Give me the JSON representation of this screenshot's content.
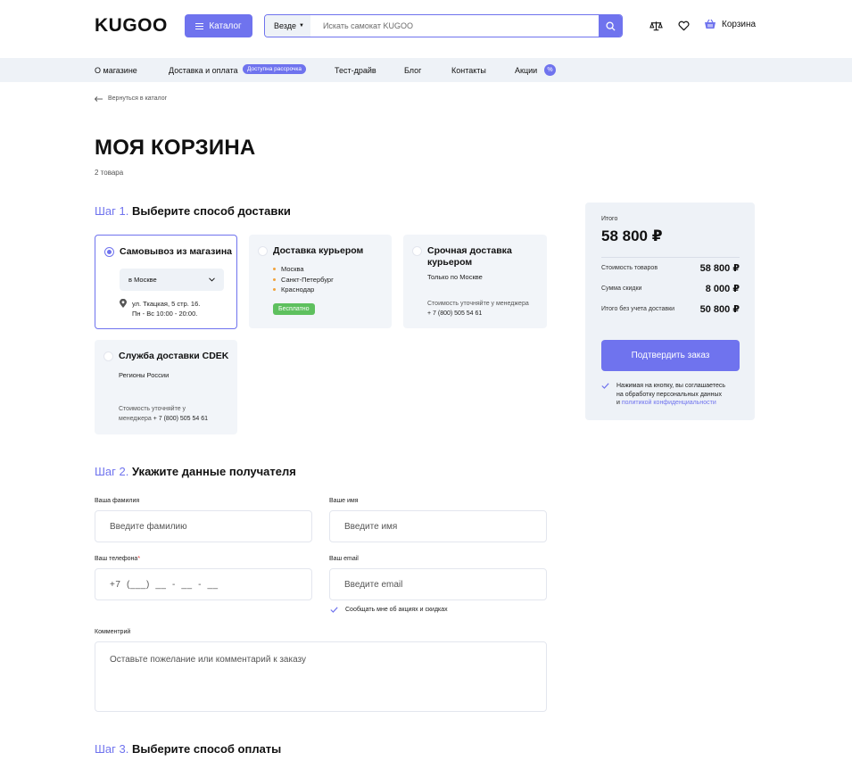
{
  "header": {
    "logo": "KUGOO",
    "catalog_label": "Каталог",
    "search_scope": "Везде",
    "search_placeholder": "Искать самокат KUGOO",
    "cart_label": "Корзина"
  },
  "nav": {
    "items": [
      "О магазине",
      "Доставка и оплата",
      "Тест-драйв",
      "Блог",
      "Контакты",
      "Акции"
    ],
    "installment_badge": "Доступна рассрочка",
    "percent_badge": "%"
  },
  "page": {
    "back_link": "Вернуться в каталог",
    "title": "МОЯ КОРЗИНА",
    "count": "2 товара"
  },
  "step1": {
    "num": "Шаг 1.",
    "title": "Выберите способ доставки",
    "options": [
      {
        "title": "Самовывоз из магазина",
        "city": "в Москве",
        "address_line1": "ул. Ткацкая, 5 стр. 16.",
        "address_line2": "Пн - Вс 10:00 - 20:00."
      },
      {
        "title": "Доставка курьером",
        "cities": [
          "Москва",
          "Санкт-Петербург",
          "Краснодар"
        ],
        "badge": "Бесплатно"
      },
      {
        "title_line1": "Срочная доставка",
        "title_line2": "курьером",
        "subtitle": "Только по Москве",
        "note_line1": "Стоимость уточняйте у менеджера",
        "note_phone": "+ 7 (800) 505 54 61"
      },
      {
        "title": "Служба доставки CDEK",
        "subtitle": "Регионы России",
        "note_line1": "Стоимость уточняйте у",
        "note_line2": "менеджера",
        "note_phone": "+ 7 (800) 505 54 61"
      }
    ]
  },
  "summary": {
    "label": "Итого",
    "total": "58 800 ₽",
    "rows": [
      {
        "label": "Стоимость товаров",
        "value": "58 800 ₽"
      },
      {
        "label": "Сумма скидки",
        "value": "8 000 ₽"
      },
      {
        "label": "Итого без учета доставки",
        "value": "50 800 ₽"
      }
    ],
    "confirm_label": "Подтвердить заказ",
    "agree_line1": "Нажимая на кнопку, вы соглашаетесь",
    "agree_line2": "на обработку персональных данных",
    "agree_line3_prefix": "и",
    "agree_link": "политикой конфиденциальности"
  },
  "step2": {
    "num": "Шаг 2.",
    "title": "Укажите данные получателя",
    "surname_label": "Ваша фамилия",
    "surname_placeholder": "Введите фамилию",
    "name_label": "Ваше имя",
    "name_placeholder": "Введите имя",
    "phone_label": "Ваш телефона",
    "phone_required": "*",
    "phone_placeholder": "+7  (___)  __  -  __  -  __",
    "email_label": "Ваш email",
    "email_placeholder": "Введите email",
    "subscribe_label": "Сообщать мне об акциях и скидках",
    "comment_label": "Комментрий",
    "comment_placeholder": "Оставьте пожелание или комментарий к заказу"
  },
  "step3": {
    "num": "Шаг 3.",
    "title": "Выберите способ оплаты"
  },
  "colors": {
    "accent": "#6f73ee",
    "panel": "#eef2f7",
    "free": "#5ec05e",
    "bullet": "#f0a23c"
  }
}
